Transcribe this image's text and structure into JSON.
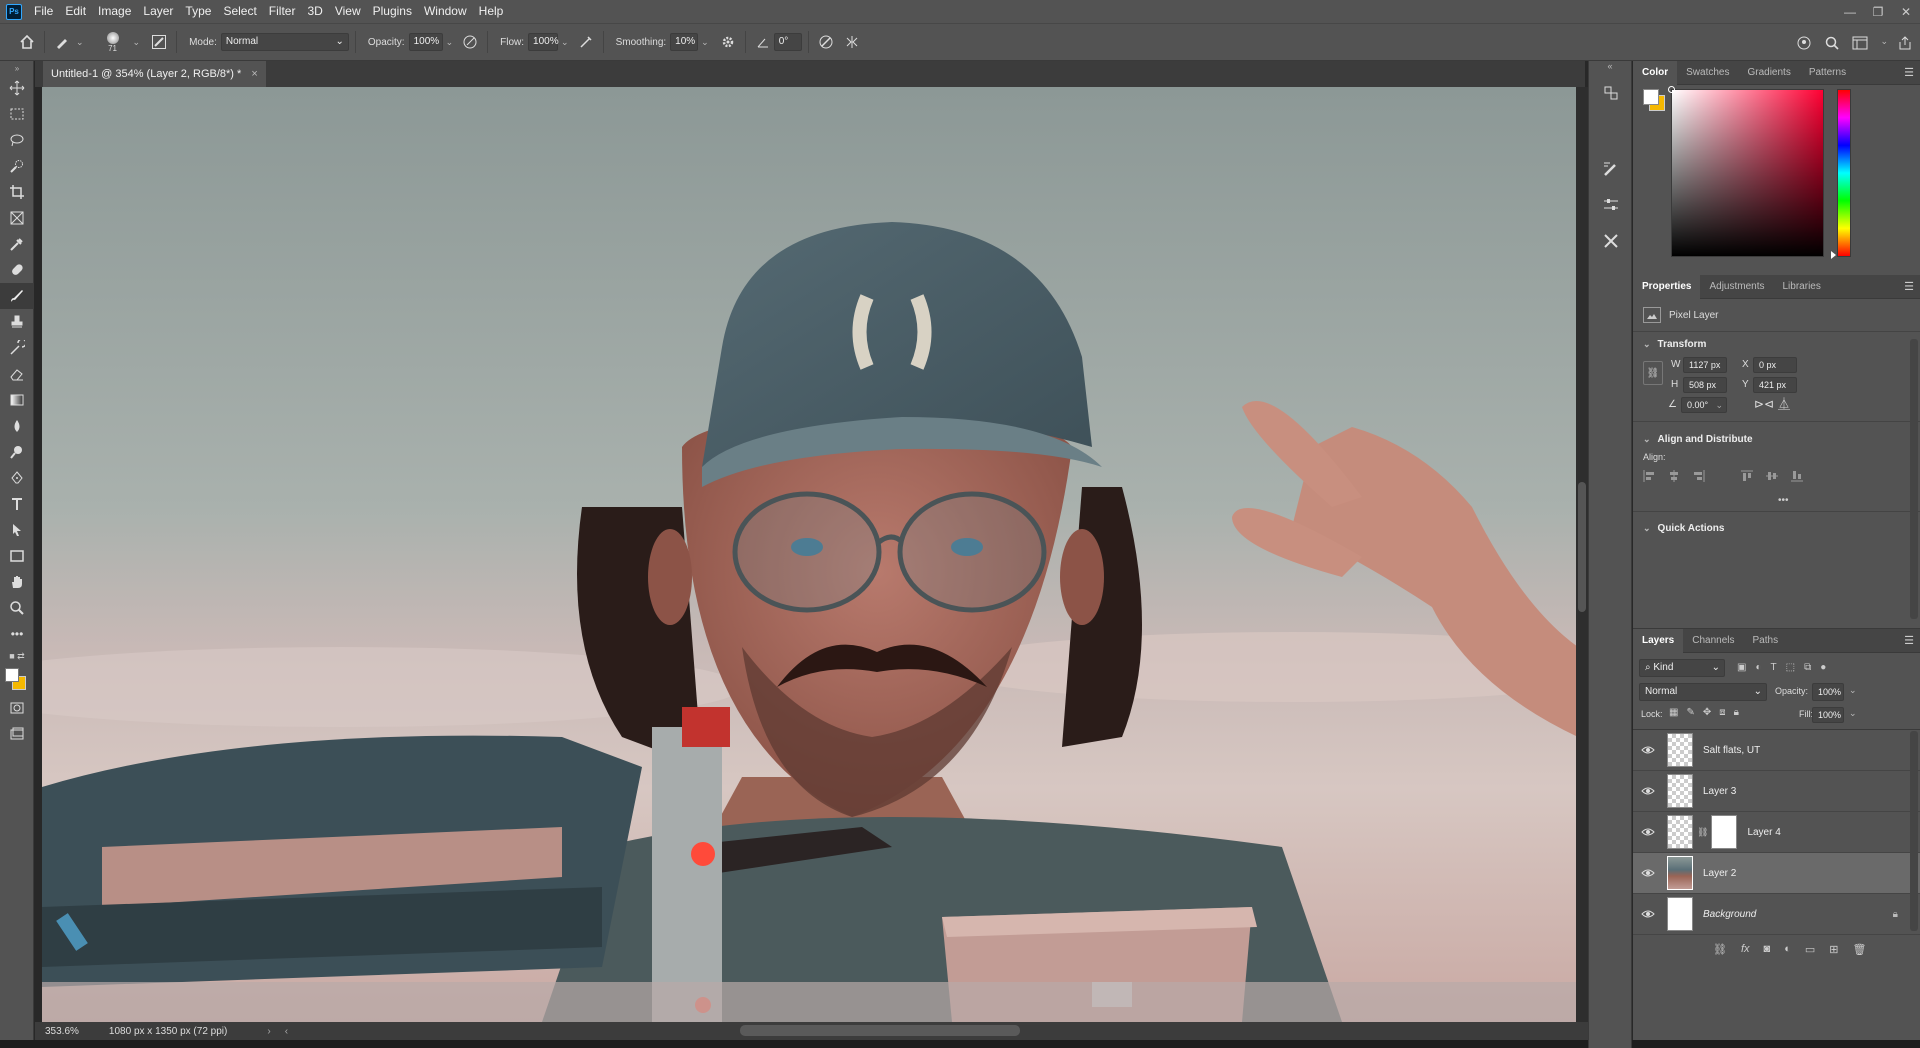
{
  "app": {
    "logo": "Ps"
  },
  "menu": [
    "File",
    "Edit",
    "Image",
    "Layer",
    "Type",
    "Select",
    "Filter",
    "3D",
    "View",
    "Plugins",
    "Window",
    "Help"
  ],
  "options_bar": {
    "brush_size": "71",
    "mode_label": "Mode:",
    "mode_value": "Normal",
    "opacity_label": "Opacity:",
    "opacity_value": "100%",
    "flow_label": "Flow:",
    "flow_value": "100%",
    "smoothing_label": "Smoothing:",
    "smoothing_value": "10%",
    "angle_value": "0°"
  },
  "document": {
    "tab_title": "Untitled-1 @ 354% (Layer 2, RGB/8*) *",
    "zoom": "353.6%",
    "doc_info": "1080 px x 1350 px (72 ppi)"
  },
  "color_panel": {
    "tabs": [
      "Color",
      "Swatches",
      "Gradients",
      "Patterns"
    ],
    "active_tab": "Color",
    "foreground": "#ffffff",
    "background": "#f5b800",
    "hue_color": "#ff0033"
  },
  "properties": {
    "tabs": [
      "Properties",
      "Adjustments",
      "Libraries"
    ],
    "kind": "Pixel Layer",
    "transform_title": "Transform",
    "w_label": "W",
    "w_value": "1127 px",
    "h_label": "H",
    "h_value": "508 px",
    "x_label": "X",
    "x_value": "0 px",
    "y_label": "Y",
    "y_value": "421 px",
    "angle_value": "0.00°",
    "align_title": "Align and Distribute",
    "align_label": "Align:",
    "more": "•••",
    "quick_actions_title": "Quick Actions"
  },
  "layers_panel": {
    "tabs": [
      "Layers",
      "Channels",
      "Paths"
    ],
    "filter_label": "Kind",
    "blend_mode": "Normal",
    "opacity_label": "Opacity:",
    "opacity_value": "100%",
    "lock_label": "Lock:",
    "fill_label": "Fill:",
    "fill_value": "100%",
    "layers": [
      {
        "name": "Salt flats, UT"
      },
      {
        "name": "Layer 3"
      },
      {
        "name": "Layer 4"
      },
      {
        "name": "Layer 2"
      },
      {
        "name": "Background"
      }
    ],
    "selected_layer": "Layer 2"
  }
}
